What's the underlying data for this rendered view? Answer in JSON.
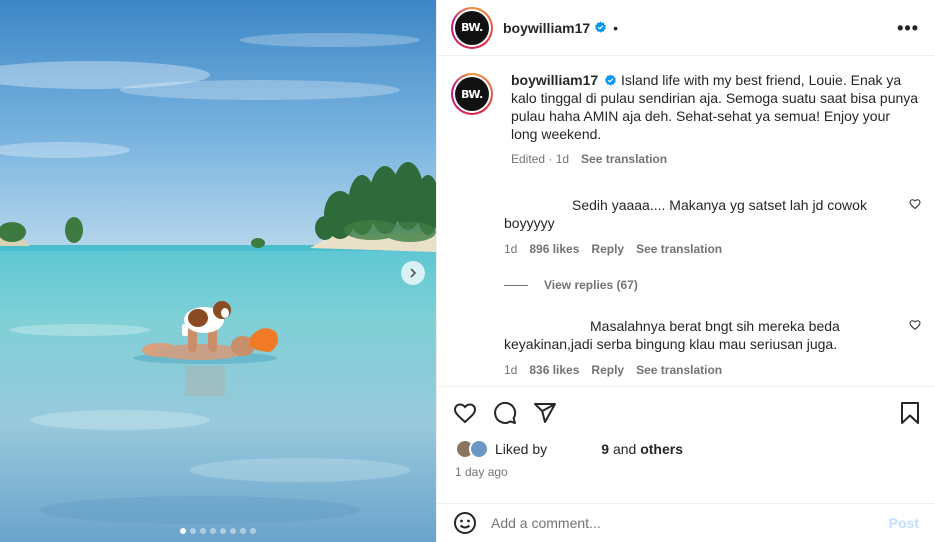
{
  "post": {
    "username": "boywilliam17",
    "avatar_text": "BW.",
    "header_bullet": "•",
    "more_icon": "•••",
    "photo_description_icon": "photo",
    "carousel_total": 8,
    "carousel_index": 1
  },
  "caption": {
    "username": "boywilliam17",
    "text": "Island life with my best friend, Louie. Enak ya kalo tinggal di pulau sendirian aja. Semoga suatu saat bisa punya pulau haha AMIN aja deh. Sehat-sehat ya semua! Enjoy your long weekend.",
    "edited": "Edited · 1d",
    "see_translation": "See translation"
  },
  "comments": [
    {
      "text": "Sedih yaaaa.... Makanya yg satset lah jd cowok boyyyyy",
      "time": "1d",
      "likes": "896 likes",
      "reply": "Reply",
      "see_translation": "See translation"
    },
    {
      "text": "Masalahnya berat bngt sih mereka beda keyakinan,jadi serba bingung klau mau seriusan juga.",
      "time": "1d",
      "likes": "836 likes",
      "reply": "Reply",
      "see_translation": "See translation"
    }
  ],
  "view_replies": "View replies (67)",
  "likes": {
    "prefix": "Liked by",
    "user": "9",
    "and": "and",
    "others": "others"
  },
  "time_ago": "1 day ago",
  "add_comment": {
    "placeholder": "Add a comment...",
    "post_label": "Post"
  },
  "colors": {
    "verified": "#0095f6",
    "post_disabled": "#c0dffd",
    "muted": "#737373"
  }
}
